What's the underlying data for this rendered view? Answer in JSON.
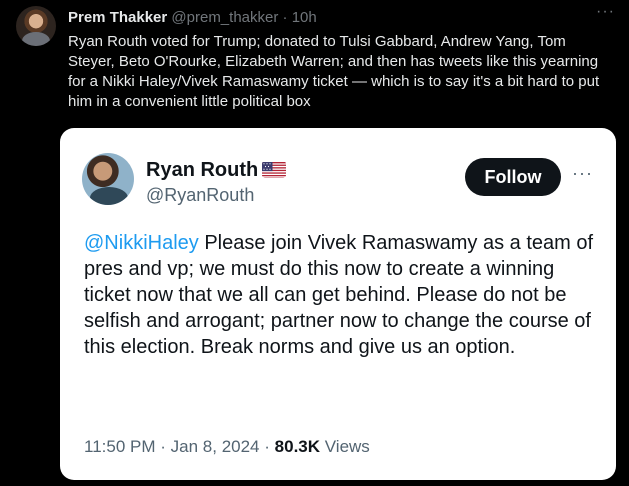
{
  "post": {
    "author_name": "Prem Thakker",
    "author_handle": "@prem_thakker",
    "separator": "·",
    "time": "10h",
    "text": "Ryan Routh voted for Trump; donated to Tulsi Gabbard, Andrew Yang, Tom Steyer, Beto O'Rourke, Elizabeth Warren; and then has tweets like this yearning for a Nikki Haley/Vivek Ramaswamy ticket — which is to say it's a bit hard to put him in a convenient little political box",
    "more_icon": "···"
  },
  "quoted": {
    "author_name": "Ryan Routh",
    "flag_icon": "us-flag-icon",
    "author_handle": "@RyanRouth",
    "follow_label": "Follow",
    "more_icon": "···",
    "mention": "@NikkiHaley",
    "text": "Please join Vivek Ramaswamy as a team  of pres and vp; we must do this now to create a winning ticket now that we all can get behind. Please do not be selfish and arrogant; partner now to change the course of this election. Break norms and give us an option.",
    "time": "11:50 PM",
    "date": "Jan 8, 2024",
    "separator": "·",
    "views_count": "80.3K",
    "views_label": "Views"
  },
  "colors": {
    "background": "#000000",
    "card": "#ffffff",
    "mention": "#1d9bf0",
    "follow_button": "#0f1419"
  }
}
